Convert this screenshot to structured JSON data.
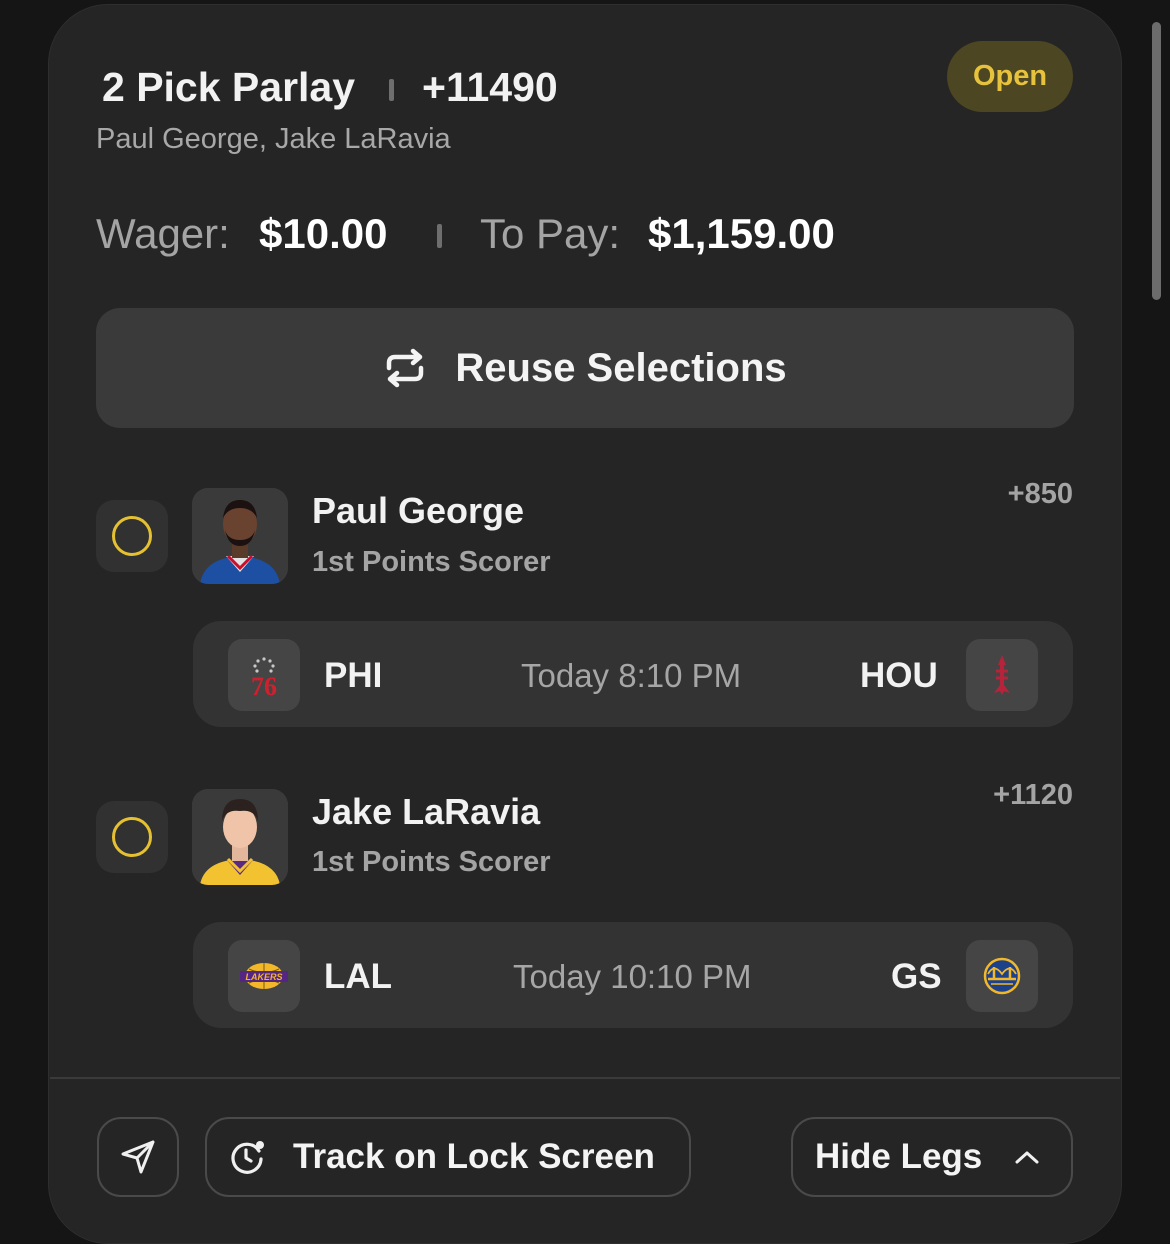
{
  "header": {
    "title": "2 Pick Parlay",
    "odds": "+11490",
    "subtitle": "Paul George, Jake LaRavia",
    "status": "Open"
  },
  "wager": {
    "wager_label": "Wager:",
    "wager_value": "$10.00",
    "pay_label": "To Pay:",
    "pay_value": "$1,159.00"
  },
  "reuse_button": {
    "label": "Reuse Selections",
    "icon": "repeat-icon"
  },
  "legs": [
    {
      "player": "Paul George",
      "market": "1st Points Scorer",
      "odds": "+850",
      "game": {
        "away": "PHI",
        "away_logo_text": "76",
        "time": "Today 8:10 PM",
        "home": "HOU",
        "home_logo_icon": "rockets-logo-icon"
      }
    },
    {
      "player": "Jake LaRavia",
      "market": "1st Points Scorer",
      "odds": "+1120",
      "game": {
        "away": "LAL",
        "away_logo_text": "LAKERS",
        "time": "Today 10:10 PM",
        "home": "GS",
        "home_logo_icon": "warriors-logo-icon"
      }
    }
  ],
  "footer": {
    "share_icon": "send-icon",
    "track_label": "Track on Lock Screen",
    "hide_label": "Hide Legs"
  },
  "colors": {
    "accent_yellow": "#e5c131",
    "badge_bg": "#4d4622",
    "card_bg": "#252525",
    "page_bg": "#151515"
  }
}
